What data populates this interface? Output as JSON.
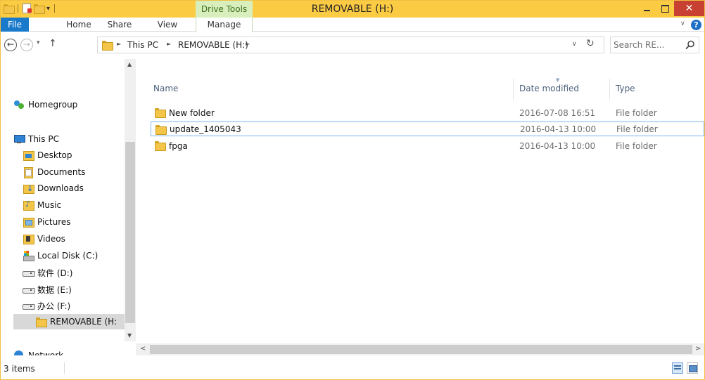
{
  "window": {
    "title": "REMOVABLE (H:)",
    "context_tab_group": "Drive Tools",
    "close_glyph": "✕"
  },
  "ribbon": {
    "tabs": [
      {
        "label": "File",
        "active": true
      },
      {
        "label": "Home"
      },
      {
        "label": "Share"
      },
      {
        "label": "View"
      },
      {
        "label": "Manage"
      }
    ],
    "help_glyph": "?"
  },
  "address": {
    "crumbs": [
      "This PC",
      "REMOVABLE (H:)"
    ],
    "search_placeholder": "Search RE..."
  },
  "navigation": {
    "items": [
      {
        "label": "Homegroup",
        "icon": "homegroup-icon"
      },
      {
        "label": "This PC",
        "icon": "computer-icon"
      },
      {
        "label": "Desktop",
        "icon": "desktop-folder-icon"
      },
      {
        "label": "Documents",
        "icon": "documents-folder-icon"
      },
      {
        "label": "Downloads",
        "icon": "downloads-folder-icon"
      },
      {
        "label": "Music",
        "icon": "music-folder-icon"
      },
      {
        "label": "Pictures",
        "icon": "pictures-folder-icon"
      },
      {
        "label": "Videos",
        "icon": "videos-folder-icon"
      },
      {
        "label": "Local Disk (C:)",
        "icon": "local-disk-icon"
      },
      {
        "label": "软件 (D:)",
        "icon": "drive-icon"
      },
      {
        "label": "数据 (E:)",
        "icon": "drive-icon"
      },
      {
        "label": "办公 (F:)",
        "icon": "drive-icon"
      },
      {
        "label": "REMOVABLE (H:",
        "icon": "folder-icon",
        "selected": true
      },
      {
        "label": "Network",
        "icon": "network-icon"
      }
    ]
  },
  "file_list": {
    "columns": [
      "Name",
      "Date modified",
      "Type"
    ],
    "rows": [
      {
        "name": "New folder",
        "date": "2016-07-08 16:51",
        "type": "File folder"
      },
      {
        "name": "update_1405043",
        "date": "2016-04-13 10:00",
        "type": "File folder",
        "selected": true
      },
      {
        "name": "fpga",
        "date": "2016-04-13 10:00",
        "type": "File folder"
      }
    ]
  },
  "status": {
    "item_count": "3 items"
  },
  "colors": {
    "title_bar": "#fbcb44",
    "drive_tools": "#d8efbd",
    "file_tab": "#1979ca",
    "close_button": "#c84031",
    "selection_border": "#7eb4ea"
  }
}
